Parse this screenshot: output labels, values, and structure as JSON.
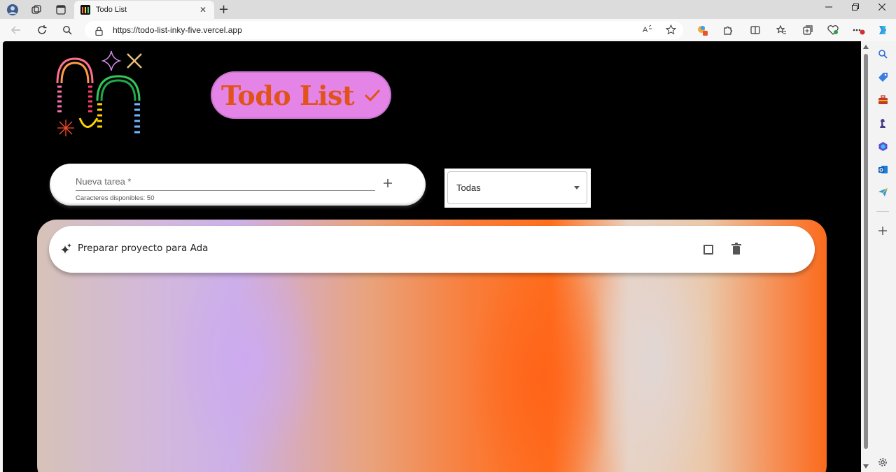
{
  "browser": {
    "tab_title": "Todo List",
    "url": "https://todo-list-inky-five.vercel.app",
    "new_tab_symbol": "+",
    "close_symbol": "✕"
  },
  "app": {
    "title": "Todo List",
    "input_placeholder": "Nueva tarea *",
    "input_helper": "Caracteres disponibles: 50",
    "filter_value": "Todas",
    "tasks": [
      {
        "text": "Preparar proyecto para Ada"
      }
    ]
  },
  "colors": {
    "title_pill": "#e384e6",
    "title_text": "#e0541b",
    "page_bg": "#000000"
  }
}
